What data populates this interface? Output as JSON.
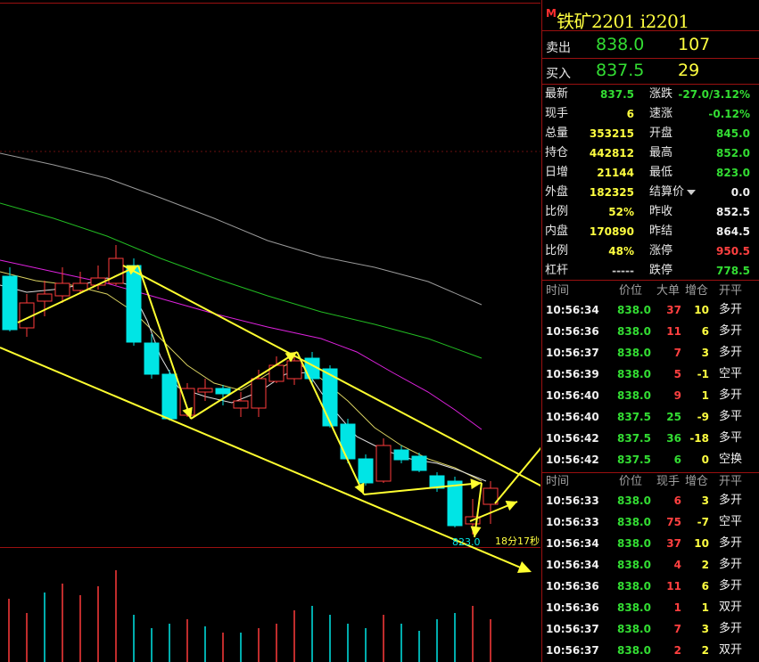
{
  "colors": {
    "up": "#ff3b3b",
    "down": "#00e5e5",
    "green": "#33dd33",
    "yellow": "#ffff40",
    "red": "#ff4040",
    "white": "#f0f0f0"
  },
  "chart": {
    "low_label": "823.0",
    "countdown": "18分17秒"
  },
  "header": {
    "marker": "M",
    "title": "铁矿2201  i2201"
  },
  "quote": {
    "ask": {
      "label": "卖出",
      "price": "838.0",
      "volume": "107"
    },
    "bid": {
      "label": "买入",
      "price": "837.5",
      "volume": "29"
    }
  },
  "stats_left": [
    {
      "label": "最新",
      "value": "837.5",
      "color": "#33dd33"
    },
    {
      "label": "现手",
      "value": "6",
      "color": "#ffff40"
    },
    {
      "label": "总量",
      "value": "353215",
      "color": "#ffff40"
    },
    {
      "label": "持仓",
      "value": "442812",
      "color": "#ffff40"
    },
    {
      "label": "日增",
      "value": "21144",
      "color": "#ffff40"
    },
    {
      "label": "外盘",
      "value": "182325",
      "color": "#ffff40"
    },
    {
      "label": "比例",
      "value": "52%",
      "color": "#ffff40"
    },
    {
      "label": "内盘",
      "value": "170890",
      "color": "#ffff40"
    },
    {
      "label": "比例",
      "value": "48%",
      "color": "#ffff40"
    },
    {
      "label": "杠杆",
      "value": "-----",
      "color": "#c8c8c8"
    }
  ],
  "stats_right": [
    {
      "label": "涨跌",
      "value": "-27.0/3.12%",
      "color": "#33dd33"
    },
    {
      "label": "速涨",
      "value": "-0.12%",
      "color": "#33dd33"
    },
    {
      "label": "开盘",
      "value": "845.0",
      "color": "#33dd33"
    },
    {
      "label": "最高",
      "value": "852.0",
      "color": "#33dd33"
    },
    {
      "label": "最低",
      "value": "823.0",
      "color": "#33dd33"
    },
    {
      "label": "结算价",
      "value": "0.0",
      "color": "#f0f0f0"
    },
    {
      "label": "昨收",
      "value": "852.5",
      "color": "#f0f0f0"
    },
    {
      "label": "昨结",
      "value": "864.5",
      "color": "#f0f0f0"
    },
    {
      "label": "涨停",
      "value": "950.5",
      "color": "#ff4040"
    },
    {
      "label": "跌停",
      "value": "778.5",
      "color": "#33dd33"
    }
  ],
  "ticks1": {
    "headers": {
      "time": "时间",
      "price": "价位",
      "big": "大单",
      "chg": "增仓",
      "type": "开平"
    },
    "rows": [
      {
        "time": "10:56:34",
        "price": "838.0",
        "vol": "37",
        "chg": "10",
        "type": "多开",
        "vc": "#ff4040",
        "cc": "#ffff40"
      },
      {
        "time": "10:56:36",
        "price": "838.0",
        "vol": "11",
        "chg": "6",
        "type": "多开",
        "vc": "#ff4040",
        "cc": "#ffff40"
      },
      {
        "time": "10:56:37",
        "price": "838.0",
        "vol": "7",
        "chg": "3",
        "type": "多开",
        "vc": "#ff4040",
        "cc": "#ffff40"
      },
      {
        "time": "10:56:39",
        "price": "838.0",
        "vol": "5",
        "chg": "-1",
        "type": "空平",
        "vc": "#ff4040",
        "cc": "#ffff40"
      },
      {
        "time": "10:56:40",
        "price": "838.0",
        "vol": "9",
        "chg": "1",
        "type": "多开",
        "vc": "#ff4040",
        "cc": "#ffff40"
      },
      {
        "time": "10:56:40",
        "price": "837.5",
        "vol": "25",
        "chg": "-9",
        "type": "多平",
        "vc": "#33dd33",
        "cc": "#ffff40"
      },
      {
        "time": "10:56:42",
        "price": "837.5",
        "vol": "36",
        "chg": "-18",
        "type": "多平",
        "vc": "#33dd33",
        "cc": "#ffff40"
      },
      {
        "time": "10:56:42",
        "price": "837.5",
        "vol": "6",
        "chg": "0",
        "type": "空换",
        "vc": "#33dd33",
        "cc": "#ffff40"
      }
    ]
  },
  "ticks2": {
    "headers": {
      "time": "时间",
      "price": "价位",
      "big": "现手",
      "chg": "增仓",
      "type": "开平"
    },
    "rows": [
      {
        "time": "10:56:33",
        "price": "838.0",
        "vol": "6",
        "chg": "3",
        "type": "多开",
        "vc": "#ff4040",
        "cc": "#ffff40"
      },
      {
        "time": "10:56:33",
        "price": "838.0",
        "vol": "75",
        "chg": "-7",
        "type": "空平",
        "vc": "#ff4040",
        "cc": "#ffff40"
      },
      {
        "time": "10:56:34",
        "price": "838.0",
        "vol": "37",
        "chg": "10",
        "type": "多开",
        "vc": "#ff4040",
        "cc": "#ffff40"
      },
      {
        "time": "10:56:34",
        "price": "838.0",
        "vol": "4",
        "chg": "2",
        "type": "多开",
        "vc": "#ff4040",
        "cc": "#ffff40"
      },
      {
        "time": "10:56:36",
        "price": "838.0",
        "vol": "11",
        "chg": "6",
        "type": "多开",
        "vc": "#ff4040",
        "cc": "#ffff40"
      },
      {
        "time": "10:56:36",
        "price": "838.0",
        "vol": "1",
        "chg": "1",
        "type": "双开",
        "vc": "#ff4040",
        "cc": "#ffff40"
      },
      {
        "time": "10:56:37",
        "price": "838.0",
        "vol": "7",
        "chg": "3",
        "type": "多开",
        "vc": "#ff4040",
        "cc": "#ffff40"
      },
      {
        "time": "10:56:37",
        "price": "838.0",
        "vol": "2",
        "chg": "2",
        "type": "双开",
        "vc": "#ff4040",
        "cc": "#ffff40"
      }
    ]
  }
}
